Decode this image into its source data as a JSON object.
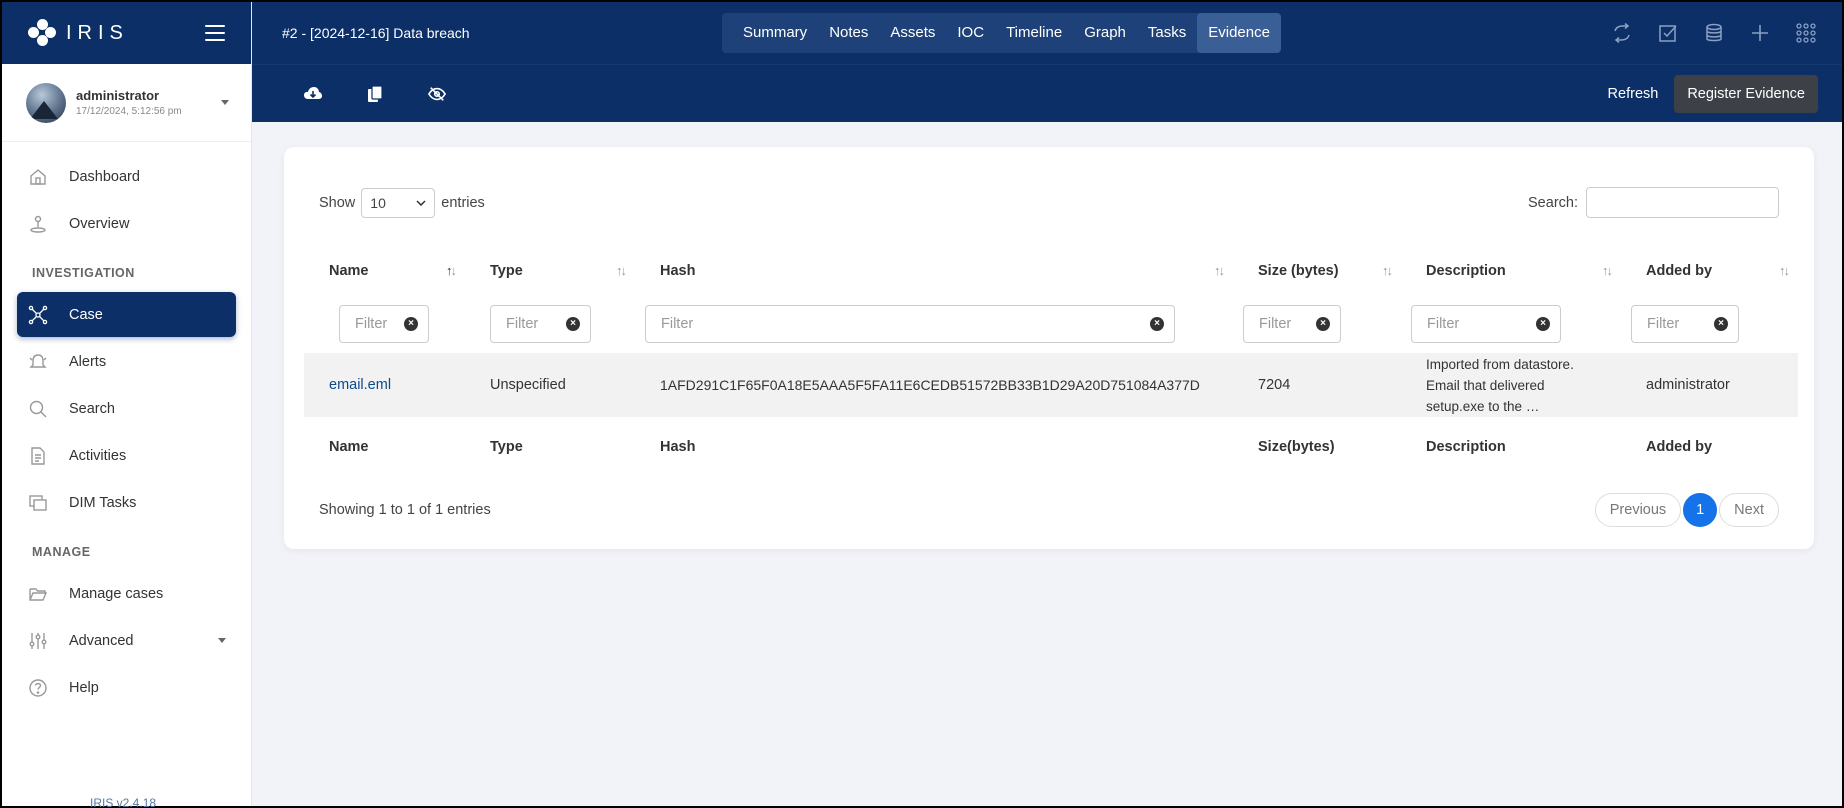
{
  "app": {
    "logo_text": "IRIS",
    "version": "IRIS v2.4.18"
  },
  "user": {
    "name": "administrator",
    "time": "17/12/2024, 5:12:56 pm"
  },
  "nav": {
    "dashboard": "Dashboard",
    "overview": "Overview",
    "section_investigation": "INVESTIGATION",
    "case": "Case",
    "alerts": "Alerts",
    "search": "Search",
    "activities": "Activities",
    "dim_tasks": "DIM Tasks",
    "section_manage": "MANAGE",
    "manage_cases": "Manage cases",
    "advanced": "Advanced",
    "help": "Help"
  },
  "header": {
    "case_title": "#2 - [2024-12-16] Data breach",
    "tabs": [
      "Summary",
      "Notes",
      "Assets",
      "IOC",
      "Timeline",
      "Graph",
      "Tasks",
      "Evidence"
    ],
    "active_tab": "Evidence"
  },
  "toolbar": {
    "refresh_label": "Refresh",
    "register_label": "Register Evidence"
  },
  "table": {
    "show_label": "Show",
    "entries_label": "entries",
    "page_size": "10",
    "search_label": "Search:",
    "filter_placeholder": "Filter",
    "columns": [
      "Name",
      "Type",
      "Hash",
      "Size (bytes)",
      "Description",
      "Added by"
    ],
    "footer_columns": [
      "Name",
      "Type",
      "Hash",
      "Size(bytes)",
      "Description",
      "Added by"
    ],
    "rows": [
      {
        "name": "email.eml",
        "type": "Unspecified",
        "hash": "1AFD291C1F65F0A18E5AAA5F5FA11E6CEDB51572BB33B1D29A20D751084A377D",
        "size": "7204",
        "description": "Imported from datastore. Email that delivered setup.exe to the …",
        "added_by": "administrator"
      }
    ],
    "info": "Showing 1 to 1 of 1 entries",
    "pager": {
      "previous": "Previous",
      "page": "1",
      "next": "Next"
    }
  },
  "colors": {
    "navy": "#0b2f66",
    "accent_blue": "#1572e8"
  }
}
